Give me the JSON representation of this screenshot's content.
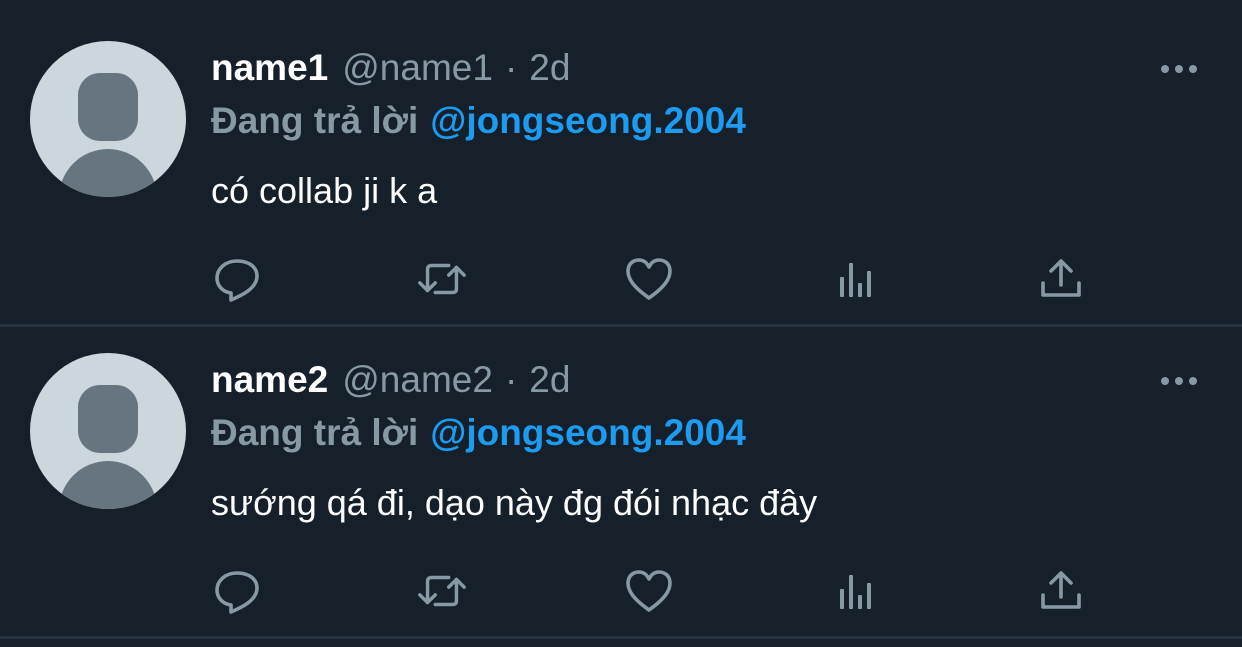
{
  "tweets": [
    {
      "display_name": "name1",
      "handle": "@name1",
      "separator": "·",
      "time": "2d",
      "reply_prefix": "Đang trả lời",
      "reply_to": "@jongseong.2004",
      "text": "có collab ji k a"
    },
    {
      "display_name": "name2",
      "handle": "@name2",
      "separator": "·",
      "time": "2d",
      "reply_prefix": "Đang trả lời",
      "reply_to": "@jongseong.2004",
      "text": "sướng qá đi, dạo này đg đói nhạc đây"
    }
  ],
  "icons": {
    "more": "more-horizontal-icon",
    "reply": "reply-bubble-icon",
    "retweet": "retweet-icon",
    "like": "heart-icon",
    "stats": "bar-chart-icon",
    "share": "share-upload-icon"
  },
  "colors": {
    "background": "#15202b",
    "primary_text": "#ffffff",
    "secondary_text": "#8899a6",
    "link": "#1d9bf0",
    "divider": "#253341",
    "avatar_bg": "#ccd6dd",
    "avatar_fg": "#66757f"
  }
}
